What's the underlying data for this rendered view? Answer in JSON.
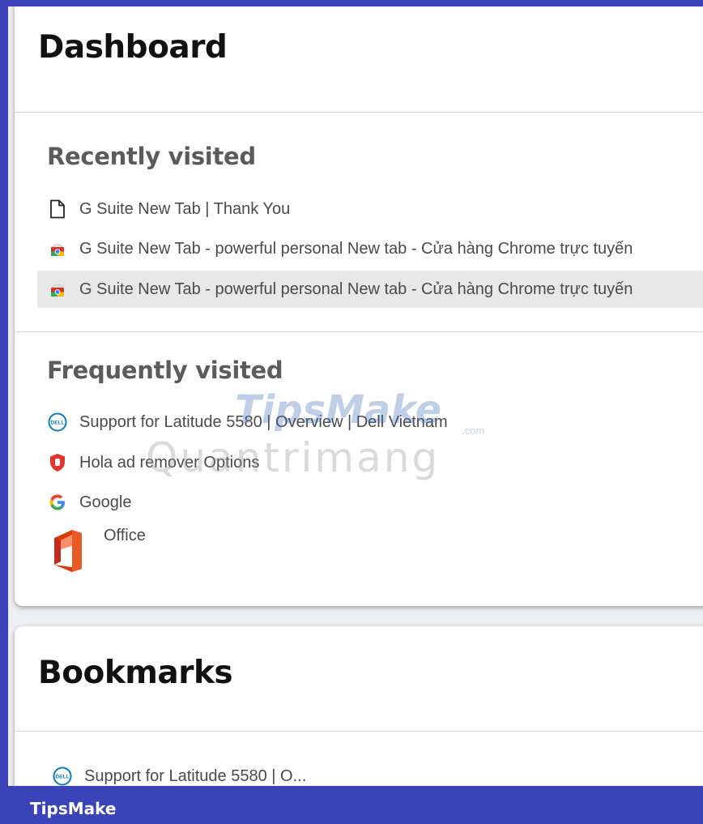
{
  "dashboard": {
    "title": "Dashboard",
    "recently_visited": {
      "heading": "Recently visited",
      "items": [
        {
          "label": "G Suite New Tab | Thank You",
          "icon": "page-icon"
        },
        {
          "label": "G Suite New Tab - powerful personal New tab - Cửa hàng Chrome trực tuyến",
          "icon": "chrome-web-store-icon"
        },
        {
          "label": "G Suite New Tab - powerful personal New tab - Cửa hàng Chrome trực tuyến",
          "icon": "chrome-web-store-icon",
          "highlighted": true
        }
      ]
    },
    "frequently_visited": {
      "heading": "Frequently visited",
      "items": [
        {
          "label": "Support for Latitude 5580 | Overview | Dell Vietnam",
          "icon": "dell-icon"
        },
        {
          "label": "Hola ad remover Options",
          "icon": "hola-shield-icon"
        },
        {
          "label": "Google",
          "icon": "google-icon"
        },
        {
          "label": "Office",
          "icon": "office-icon"
        }
      ]
    }
  },
  "bookmarks": {
    "title": "Bookmarks",
    "items": [
      {
        "label": "Support for Latitude 5580 | O...",
        "icon": "dell-icon"
      }
    ]
  },
  "watermark": {
    "brand": "TipsMake",
    "domain": ".com",
    "secondary": "Quantrimang"
  },
  "footer": {
    "brand": "TipsMake"
  },
  "colors": {
    "frame": "#3a43b8",
    "card": "#ffffff",
    "highlight": "#e8e8e8",
    "dell": "#0b7dc1",
    "hola": "#e3342f"
  }
}
